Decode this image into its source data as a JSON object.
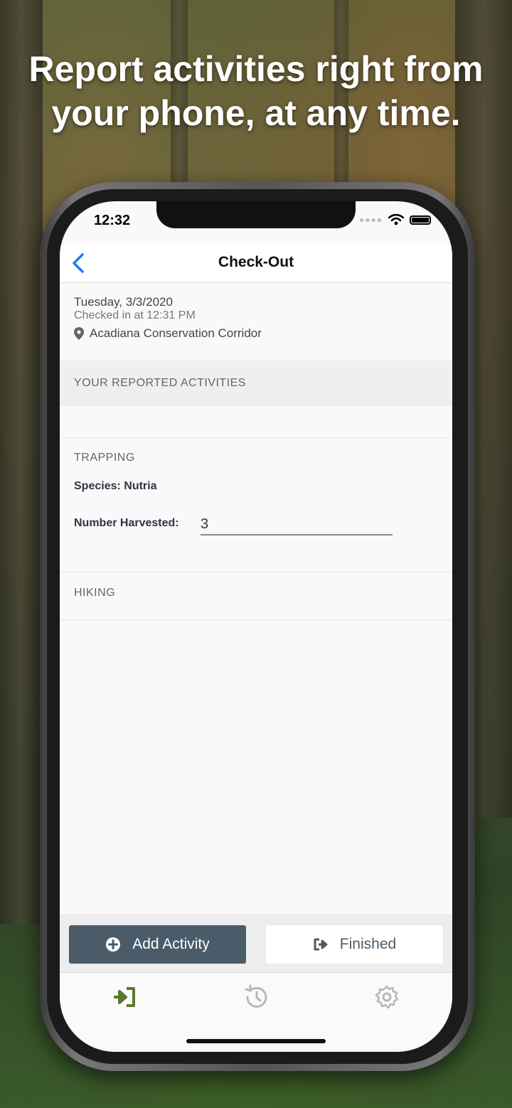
{
  "headline": {
    "line1": "Report activities right from",
    "line2": "your phone, at any time."
  },
  "status_bar": {
    "time": "12:32",
    "icons": [
      "signal-dots-icon",
      "wifi-icon",
      "battery-icon"
    ]
  },
  "nav": {
    "title": "Check-Out",
    "back_icon": "chevron-left-icon"
  },
  "checkin": {
    "date": "Tuesday, 3/3/2020",
    "checked_in": "Checked in at 12:31 PM",
    "location": "Acadiana Conservation Corridor"
  },
  "reported_header": "YOUR REPORTED ACTIVITIES",
  "activities": [
    {
      "title": "TRAPPING",
      "species_label": "Species: Nutria",
      "number_label": "Number Harvested:",
      "number_value": "3"
    },
    {
      "title": "HIKING"
    }
  ],
  "buttons": {
    "add_activity": "Add Activity",
    "finished": "Finished"
  },
  "tabs": [
    {
      "icon": "check-in-icon",
      "active": true
    },
    {
      "icon": "history-icon",
      "active": false
    },
    {
      "icon": "gear-icon",
      "active": false
    }
  ],
  "colors": {
    "accent_blue": "#1a7cf5",
    "button_dark": "#4a5c6a",
    "tab_active": "#5b7a2a",
    "tab_inactive": "#b8b8b8"
  }
}
